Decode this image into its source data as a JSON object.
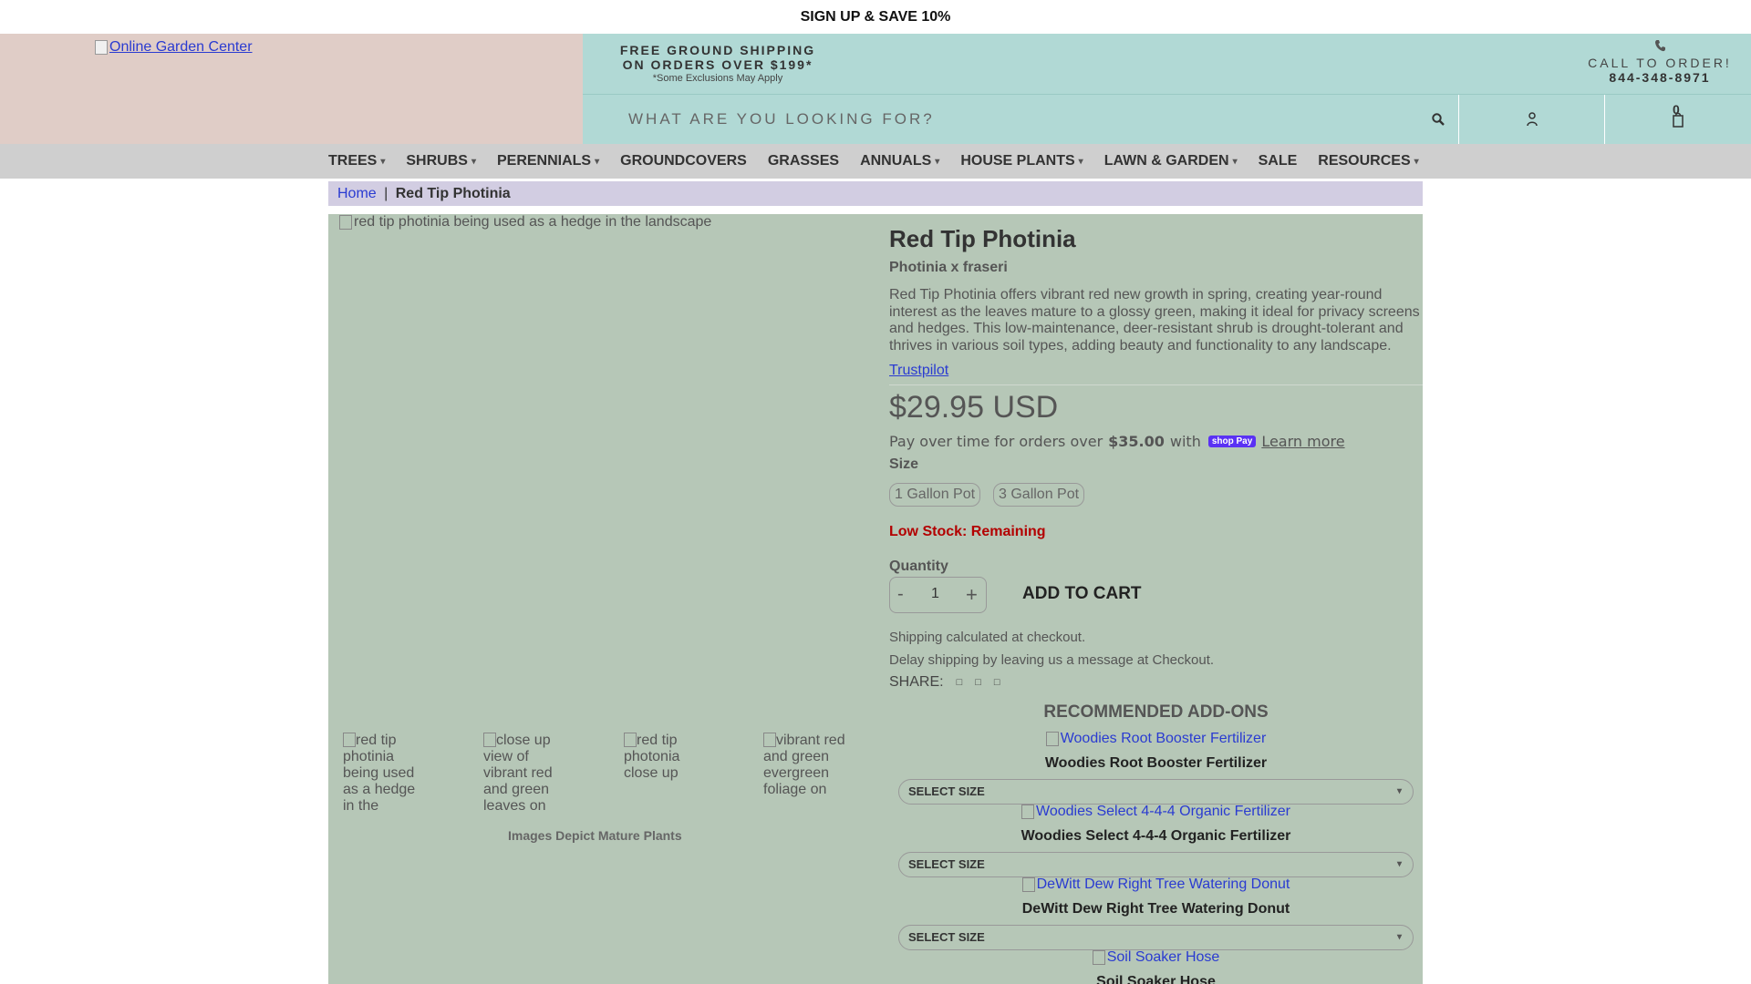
{
  "announcement": "SIGN UP & SAVE 10%",
  "header": {
    "logo_alt": "Online Garden Center",
    "shipping_line1": "FREE GROUND SHIPPING",
    "shipping_line2": "ON ORDERS OVER $199*",
    "shipping_note": "*Some Exclusions May Apply",
    "call_label": "CALL TO ORDER!",
    "phone": "844-348-8971",
    "search_placeholder": "WHAT ARE YOU LOOKING FOR?",
    "cart_count": "0"
  },
  "nav": {
    "items": [
      {
        "label": "TREES",
        "caret": "▾"
      },
      {
        "label": "SHRUBS",
        "caret": "▾"
      },
      {
        "label": "PERENNIALS",
        "caret": "▾"
      },
      {
        "label": "GROUNDCOVERS"
      },
      {
        "label": "GRASSES"
      },
      {
        "label": "ANNUALS",
        "caret": "▾"
      },
      {
        "label": "HOUSE PLANTS",
        "caret": "▾"
      },
      {
        "label": "LAWN & GARDEN",
        "caret": "▾"
      },
      {
        "label": "SALE"
      },
      {
        "label": "RESOURCES",
        "caret": "▾"
      }
    ]
  },
  "breadcrumb": {
    "home": "Home",
    "separator": "|",
    "current": "Red Tip Photinia"
  },
  "gallery": {
    "main_alt": "red tip photinia being used as a hedge in the landscape",
    "thumbs": [
      "red tip photinia being used as a hedge in the",
      "close up view of vibrant red and green leaves on",
      "red tip photonia close up",
      "vibrant red and green evergreen foliage on"
    ],
    "note": "Images Depict Mature Plants"
  },
  "product": {
    "title": "Red Tip Photinia",
    "scientific_name": "Photinia x fraseri",
    "description": "Red Tip Photinia offers vibrant red new growth in spring, creating year-round interest as the leaves mature to a glossy green, making it ideal for privacy screens and hedges. This low-maintenance, deer-resistant shrub is drought-tolerant and thrives in various soil types, adding beauty and functionality to any landscape.",
    "trustpilot": "Trustpilot",
    "price": "$29.95 USD",
    "installments_text": "Pay over time for orders over",
    "installments_amount": "$35.00",
    "installments_with": "with",
    "shoppay_label": "shop Pay",
    "learn_more": "Learn more",
    "size_label": "Size",
    "sizes": [
      "1 Gallon Pot",
      "3 Gallon Pot"
    ],
    "stock": "Low Stock: Remaining",
    "quantity_label": "Quantity",
    "quantity": "1",
    "minus": "-",
    "plus": "+",
    "add_to_cart": "ADD TO CART",
    "shipping_note": "Shipping calculated at checkout.",
    "delay_note": "Delay shipping by leaving us a message at Checkout.",
    "share_label": "SHARE:"
  },
  "recommended": {
    "title": "RECOMMENDED ADD-ONS",
    "select_label": "SELECT SIZE",
    "items": [
      {
        "name": "Woodies Root Booster Fertilizer",
        "img_alt": "Woodies Root Booster Fertilizer"
      },
      {
        "name": "Woodies Select 4-4-4 Organic Fertilizer",
        "img_alt": "Woodies Select 4-4-4 Organic Fertilizer"
      },
      {
        "name": "DeWitt Dew Right Tree Watering Donut",
        "img_alt": "DeWitt Dew Right Tree Watering Donut"
      },
      {
        "name": "Soil Soaker Hose",
        "img_alt": "Soil Soaker Hose"
      }
    ]
  },
  "colors": {
    "logo_bg": "#e0cdc7",
    "header_bg": "#b1d9d5",
    "nav_bg": "#cfcfcf",
    "breadcrumb_bg": "#d2cde2",
    "product_bg": "#b6c7b7",
    "link": "#2a3bd1",
    "stock_red": "#b30000",
    "shoppay": "#5a31f4"
  }
}
